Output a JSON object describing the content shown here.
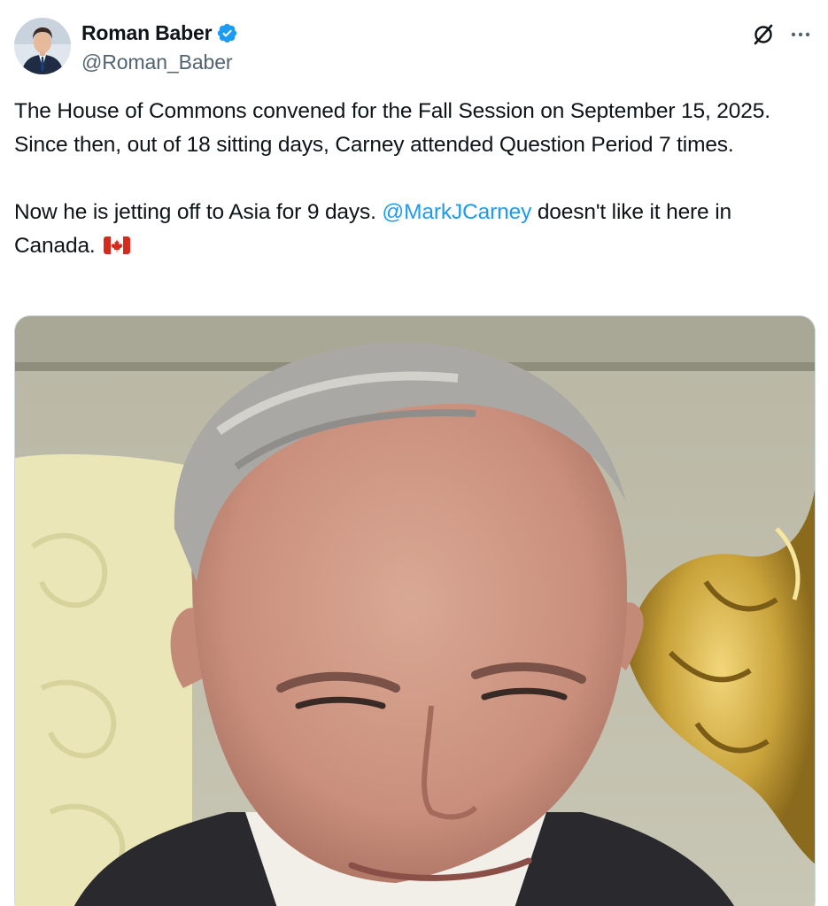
{
  "author": {
    "display_name": "Roman Baber",
    "handle": "@Roman_Baber",
    "verified": true,
    "verified_color": "#1d9bf0"
  },
  "actions": {
    "grok_icon": "grok-icon",
    "more_icon": "more-icon"
  },
  "tweet": {
    "paragraph1": "The House of Commons convened for the Fall Session on September 15, 2025. Since then, out of 18 sitting days, Carney attended Question Period 7 times.",
    "paragraph2_before": "Now he is jetting off to Asia for 9 days. ",
    "mention": "@MarkJCarney",
    "paragraph2_after": " doesn't like it here in Canada. ",
    "flag_icon": "canada-flag-icon"
  },
  "media": {
    "type": "photo"
  },
  "colors": {
    "text": "#0f1419",
    "secondary": "#536471",
    "link": "#1d9bf0",
    "border": "#cfd9de"
  }
}
